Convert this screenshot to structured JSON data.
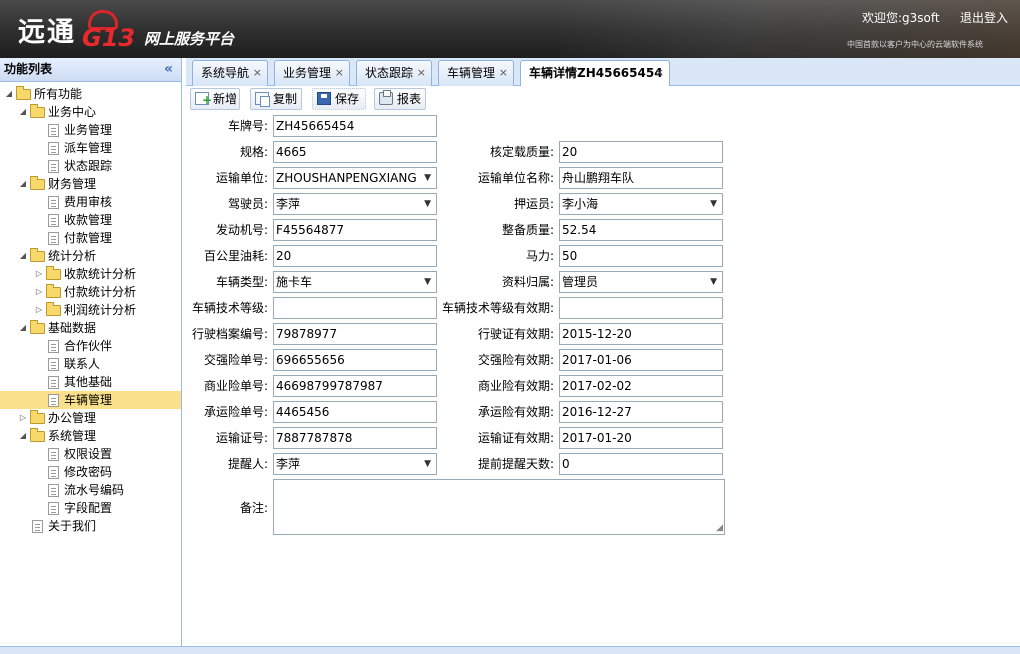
{
  "header": {
    "logo_text": "远通",
    "logo_brand": "G13",
    "platform_name": "网上服务平台",
    "welcome": "欢迎您:g3soft",
    "logout": "退出登入",
    "slogan": "中国首款以客户为中心的云端软件系统"
  },
  "sidebar": {
    "title": "功能列表",
    "collapse_icon": "double-chevron-left",
    "tree": [
      {
        "label": "所有功能",
        "level": 0,
        "type": "folder",
        "expanded": true
      },
      {
        "label": "业务中心",
        "level": 1,
        "type": "folder",
        "expanded": true
      },
      {
        "label": "业务管理",
        "level": 2,
        "type": "file"
      },
      {
        "label": "派车管理",
        "level": 2,
        "type": "file"
      },
      {
        "label": "状态跟踪",
        "level": 2,
        "type": "file"
      },
      {
        "label": "财务管理",
        "level": 1,
        "type": "folder",
        "expanded": true
      },
      {
        "label": "费用审核",
        "level": 2,
        "type": "file"
      },
      {
        "label": "收款管理",
        "level": 2,
        "type": "file"
      },
      {
        "label": "付款管理",
        "level": 2,
        "type": "file"
      },
      {
        "label": "统计分析",
        "level": 1,
        "type": "folder",
        "expanded": true
      },
      {
        "label": "收款统计分析",
        "level": 2,
        "type": "folder",
        "expanded": false
      },
      {
        "label": "付款统计分析",
        "level": 2,
        "type": "folder",
        "expanded": false
      },
      {
        "label": "利润统计分析",
        "level": 2,
        "type": "folder",
        "expanded": false
      },
      {
        "label": "基础数据",
        "level": 1,
        "type": "folder",
        "expanded": true
      },
      {
        "label": "合作伙伴",
        "level": 2,
        "type": "file"
      },
      {
        "label": "联系人",
        "level": 2,
        "type": "file"
      },
      {
        "label": "其他基础",
        "level": 2,
        "type": "file"
      },
      {
        "label": "车辆管理",
        "level": 2,
        "type": "file",
        "selected": true
      },
      {
        "label": "办公管理",
        "level": 1,
        "type": "folder",
        "expanded": false
      },
      {
        "label": "系统管理",
        "level": 1,
        "type": "folder",
        "expanded": true
      },
      {
        "label": "权限设置",
        "level": 2,
        "type": "file"
      },
      {
        "label": "修改密码",
        "level": 2,
        "type": "file"
      },
      {
        "label": "流水号编码",
        "level": 2,
        "type": "file"
      },
      {
        "label": "字段配置",
        "level": 2,
        "type": "file"
      },
      {
        "label": "关于我们",
        "level": 1,
        "type": "file"
      }
    ]
  },
  "tabs": [
    {
      "label": "系统导航",
      "close": "×"
    },
    {
      "label": "业务管理",
      "close": "×"
    },
    {
      "label": "状态跟踪",
      "close": "×"
    },
    {
      "label": "车辆管理",
      "close": "×"
    },
    {
      "label": "车辆详情ZH45665454",
      "close": "×",
      "active": true
    }
  ],
  "toolbar": {
    "new": "新增",
    "copy": "复制",
    "save": "保存",
    "report": "报表"
  },
  "form": {
    "plate_no": {
      "label": "车牌号:",
      "value": "ZH45665454"
    },
    "spec": {
      "label": "规格:",
      "value": "4665"
    },
    "rated_load": {
      "label": "核定载质量:",
      "value": "20"
    },
    "transport_unit": {
      "label": "运输单位:",
      "value": "ZHOUSHANPENGXIANG"
    },
    "transport_unit_name": {
      "label": "运输单位名称:",
      "value": "舟山鹏翔车队"
    },
    "driver": {
      "label": "驾驶员:",
      "value": "李萍"
    },
    "escort": {
      "label": "押运员:",
      "value": "李小海"
    },
    "engine_no": {
      "label": "发动机号:",
      "value": "F45564877"
    },
    "curb_weight": {
      "label": "整备质量:",
      "value": "52.54"
    },
    "fuel_per_100km": {
      "label": "百公里油耗:",
      "value": "20"
    },
    "horsepower": {
      "label": "马力:",
      "value": "50"
    },
    "vehicle_type": {
      "label": "车辆类型:",
      "value": "施卡车"
    },
    "data_owner": {
      "label": "资料归属:",
      "value": "管理员"
    },
    "tech_grade": {
      "label": "车辆技术等级:",
      "value": ""
    },
    "tech_grade_expiry": {
      "label": "车辆技术等级有效期:",
      "value": ""
    },
    "license_file_no": {
      "label": "行驶档案编号:",
      "value": "79878977"
    },
    "license_valid_until": {
      "label": "行驶证有效期:",
      "value": "2015-12-20"
    },
    "compulsory_ins_no": {
      "label": "交强险单号:",
      "value": "696655656"
    },
    "compulsory_ins_expiry": {
      "label": "交强险有效期:",
      "value": "2017-01-06"
    },
    "commercial_ins_no": {
      "label": "商业险单号:",
      "value": "46698799787987"
    },
    "commercial_ins_expiry": {
      "label": "商业险有效期:",
      "value": "2017-02-02"
    },
    "carrier_ins_no": {
      "label": "承运险单号:",
      "value": "4465456"
    },
    "carrier_ins_expiry": {
      "label": "承运险有效期:",
      "value": "2016-12-27"
    },
    "transport_cert_no": {
      "label": "运输证号:",
      "value": "7887787878"
    },
    "transport_cert_expiry": {
      "label": "运输证有效期:",
      "value": "2017-01-20"
    },
    "reminder_person": {
      "label": "提醒人:",
      "value": "李萍"
    },
    "advance_days": {
      "label": "提前提醒天数:",
      "value": "0"
    },
    "remark": {
      "label": "备注:",
      "value": ""
    }
  },
  "colors": {
    "panel_border": "#99bbe8",
    "tab_strip": "#dae7f6",
    "selected_node": "#fbe08c",
    "brand_red": "#e8292e"
  }
}
